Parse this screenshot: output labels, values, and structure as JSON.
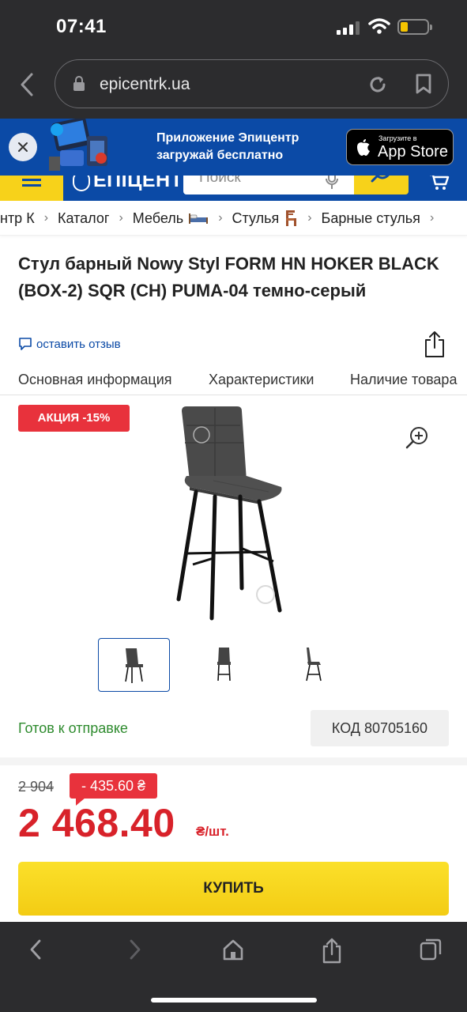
{
  "status_bar": {
    "time": "07:41"
  },
  "browser": {
    "url": "epicentrk.ua"
  },
  "app_banner": {
    "line1": "Приложение Эпицентр",
    "line2": "загружай бесплатно",
    "store_small": "Загрузите в",
    "store_big": "App Store"
  },
  "site_header": {
    "logo_text": "ЕПІЦЕНТР",
    "search_placeholder": "Поиск"
  },
  "breadcrumbs": [
    {
      "label": "нтр К"
    },
    {
      "label": "Каталог"
    },
    {
      "label": "Мебель",
      "icon": "bed-icon"
    },
    {
      "label": "Стулья",
      "icon": "chair-icon"
    },
    {
      "label": "Барные стулья"
    }
  ],
  "product": {
    "title": "Стул барный Nowy Styl FORM HN HOKER BLACK (BOX-2) SQR (CH) PUMA-04 темно-серый",
    "review_link": "оставить отзыв",
    "promo_badge": "АКЦИЯ -15%",
    "availability": "Готов к отправке",
    "code": "КОД 80705160",
    "old_price": "2 904",
    "discount": "- 435.60 ₴",
    "price": "2 468.40",
    "price_unit": "₴/шт.",
    "buy_label": "КУПИТЬ"
  },
  "tabs": [
    {
      "label": "Основная информация"
    },
    {
      "label": "Характеристики"
    },
    {
      "label": "Наличие товара"
    }
  ],
  "colors": {
    "brand_blue": "#0b4aa6",
    "brand_yellow": "#f7d21a",
    "sale_red": "#e8323c",
    "price_red": "#d8222a",
    "ready_green": "#2e8b2e"
  }
}
